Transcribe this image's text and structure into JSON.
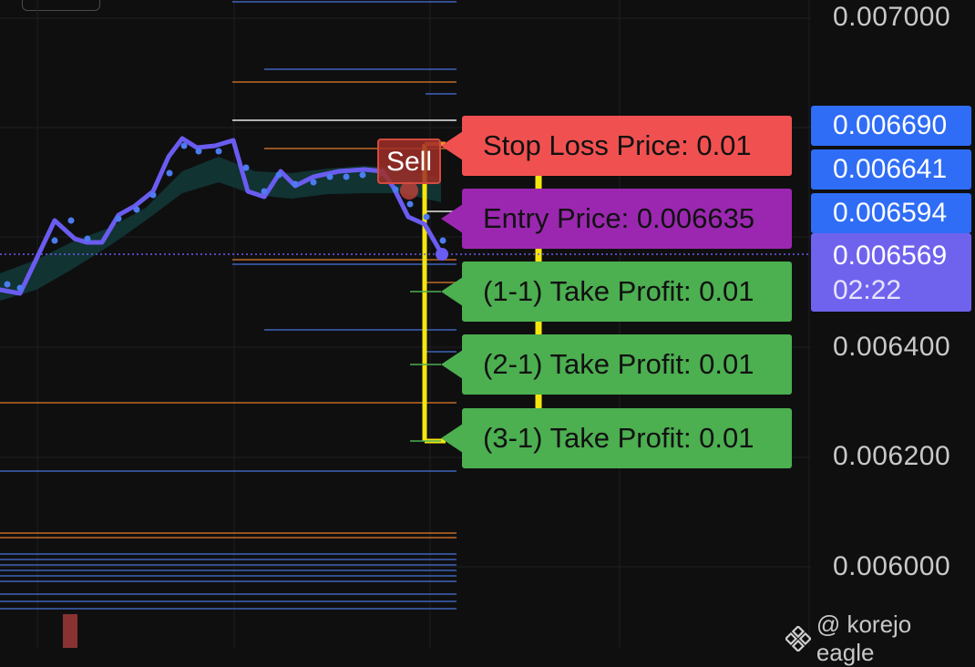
{
  "price_axis": {
    "ticks": [
      "0.007000",
      "0.006400",
      "0.006200",
      "0.006000"
    ],
    "badges": [
      {
        "value": "0.006690",
        "color": "#2f6df6"
      },
      {
        "value": "0.006641",
        "color": "#2f6df6"
      },
      {
        "value": "0.006594",
        "color": "#2f6df6"
      }
    ],
    "current": {
      "value": "0.006569",
      "countdown": "02:22",
      "color": "#6f63ee"
    }
  },
  "order_labels": {
    "stop_loss": {
      "text": "Stop Loss Price: 0.01",
      "color": "#f05150"
    },
    "entry": {
      "text": "Entry Price: 0.006635",
      "color": "#9b27b0"
    },
    "tp1": {
      "text": "(1-1) Take Profit: 0.01",
      "color": "#4caf50"
    },
    "tp2": {
      "text": "(2-1) Take Profit: 0.01",
      "color": "#4caf50"
    },
    "tp3": {
      "text": "(3-1) Take Profit: 0.01",
      "color": "#4caf50"
    }
  },
  "signal": {
    "label": "Sell"
  },
  "watermark": {
    "text": "@ korejo eagle",
    "icon": "binance-diamond-icon"
  },
  "colors": {
    "price_line": "#6a5cf0",
    "dots": "#4c7cf0",
    "band": "#123a38",
    "bracket": "#f5e60e"
  }
}
